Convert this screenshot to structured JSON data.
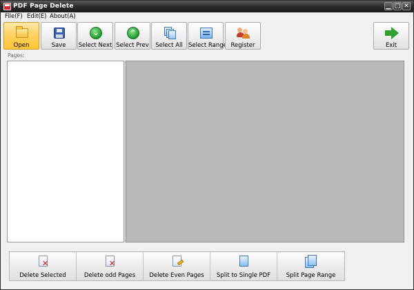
{
  "window": {
    "title": "PDF Page Delete",
    "controls": {
      "minimize": "▁",
      "maximize": "□",
      "close": "✕"
    }
  },
  "menu": [
    "File(F)",
    "Edit(E)",
    "About(A)"
  ],
  "toolbar": [
    {
      "label": "Open",
      "icon": "folder-open-icon",
      "active": true
    },
    {
      "label": "Save",
      "icon": "floppy-disk-icon"
    },
    {
      "label": "Select Next",
      "icon": "arrow-down-circle-icon"
    },
    {
      "label": "Select Prev",
      "icon": "arrow-up-circle-icon"
    },
    {
      "label": "Select All",
      "icon": "pages-stack-icon"
    },
    {
      "label": "Select Range",
      "icon": "page-range-icon"
    },
    {
      "label": "Register",
      "icon": "users-icon"
    },
    {
      "label": "Exit",
      "icon": "exit-arrow-icon"
    }
  ],
  "pages_label": "Pages:",
  "actions": [
    {
      "label": "Delete Selected",
      "icon": "delete-selected-icon"
    },
    {
      "label": "Delete odd Pages",
      "icon": "delete-odd-pages-icon"
    },
    {
      "label": "Delete Even Pages",
      "icon": "delete-even-pages-icon"
    },
    {
      "label": "Split to Single PDF",
      "icon": "split-single-icon"
    },
    {
      "label": "Split Page Range",
      "icon": "split-range-icon"
    }
  ],
  "colors": {
    "titlebar": "#2c2c2c",
    "active_button": "#ffd15c",
    "preview_background": "#b9b9b9",
    "list_background": "#ffffff"
  }
}
